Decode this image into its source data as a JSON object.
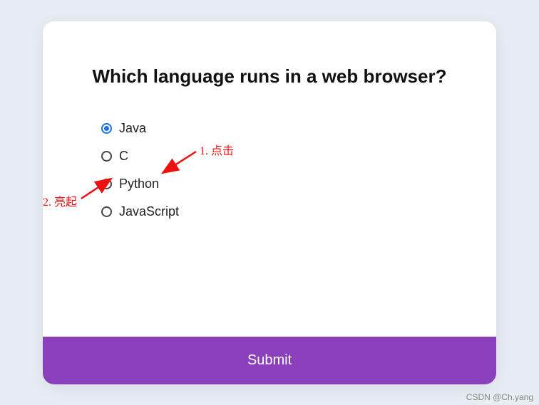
{
  "question": "Which language runs in a web browser?",
  "options": [
    {
      "label": "Java",
      "selected": true
    },
    {
      "label": "C",
      "selected": false
    },
    {
      "label": "Python",
      "selected": false
    },
    {
      "label": "JavaScript",
      "selected": false
    }
  ],
  "submit_label": "Submit",
  "annotations": {
    "label1": "1. 点击",
    "label2": "2. 亮起"
  },
  "watermark": "CSDN @Ch.yang"
}
